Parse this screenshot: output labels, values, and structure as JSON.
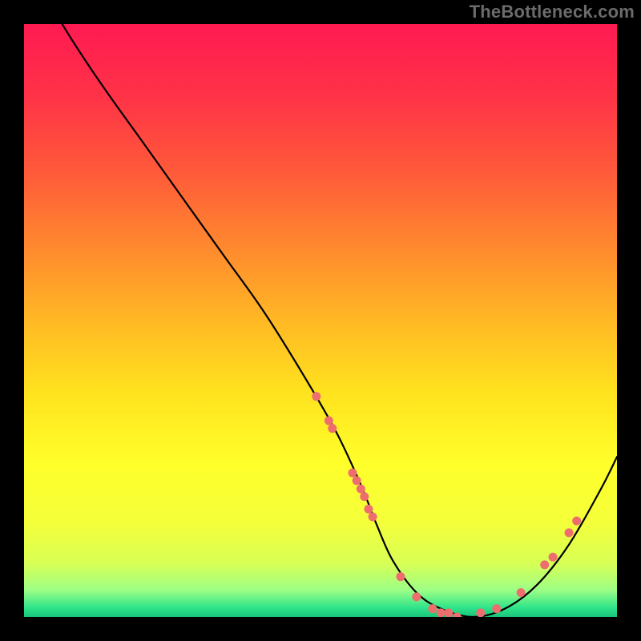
{
  "watermark": "TheBottleneck.com",
  "gradient_stops": [
    {
      "offset": 0.0,
      "color": "#ff1a52"
    },
    {
      "offset": 0.12,
      "color": "#ff3247"
    },
    {
      "offset": 0.25,
      "color": "#ff5a3a"
    },
    {
      "offset": 0.38,
      "color": "#ff8a2e"
    },
    {
      "offset": 0.5,
      "color": "#ffb824"
    },
    {
      "offset": 0.62,
      "color": "#ffe21e"
    },
    {
      "offset": 0.74,
      "color": "#ffff2a"
    },
    {
      "offset": 0.84,
      "color": "#f4ff3a"
    },
    {
      "offset": 0.91,
      "color": "#d8ff55"
    },
    {
      "offset": 0.955,
      "color": "#9cff86"
    },
    {
      "offset": 0.985,
      "color": "#2de38a"
    },
    {
      "offset": 1.0,
      "color": "#18c47a"
    }
  ],
  "chart_data": {
    "type": "line",
    "title": "",
    "xlabel": "",
    "ylabel": "",
    "xlim": [
      0,
      100
    ],
    "ylim": [
      0,
      100
    ],
    "series": [
      {
        "name": "bottleneck-curve",
        "x": [
          4.0,
          8.1,
          13.5,
          20.3,
          27.0,
          33.8,
          40.5,
          47.3,
          52.7,
          56.8,
          59.5,
          62.2,
          66.2,
          70.3,
          75.7,
          81.1,
          86.5,
          91.9,
          97.3,
          100.0
        ],
        "y": [
          104.1,
          97.3,
          89.2,
          79.7,
          70.3,
          60.8,
          51.4,
          40.5,
          31.1,
          22.3,
          15.5,
          9.5,
          4.1,
          1.4,
          0.0,
          1.4,
          5.4,
          12.2,
          21.6,
          27.0
        ]
      }
    ],
    "markers": {
      "description": "highlighted points along the curve",
      "points": [
        {
          "x": 49.3,
          "y": 37.2
        },
        {
          "x": 51.4,
          "y": 33.1
        },
        {
          "x": 52.0,
          "y": 31.8
        },
        {
          "x": 55.4,
          "y": 24.3
        },
        {
          "x": 56.1,
          "y": 23.0
        },
        {
          "x": 56.8,
          "y": 21.6
        },
        {
          "x": 57.4,
          "y": 20.3
        },
        {
          "x": 58.1,
          "y": 18.2
        },
        {
          "x": 58.8,
          "y": 16.9
        },
        {
          "x": 63.5,
          "y": 6.8
        },
        {
          "x": 66.2,
          "y": 3.4
        },
        {
          "x": 68.9,
          "y": 1.4
        },
        {
          "x": 70.3,
          "y": 0.7
        },
        {
          "x": 71.6,
          "y": 0.7
        },
        {
          "x": 73.0,
          "y": 0.0
        },
        {
          "x": 77.0,
          "y": 0.7
        },
        {
          "x": 79.7,
          "y": 1.4
        },
        {
          "x": 83.8,
          "y": 4.1
        },
        {
          "x": 87.8,
          "y": 8.8
        },
        {
          "x": 89.2,
          "y": 10.1
        },
        {
          "x": 91.9,
          "y": 14.2
        },
        {
          "x": 93.2,
          "y": 16.2
        }
      ]
    }
  }
}
